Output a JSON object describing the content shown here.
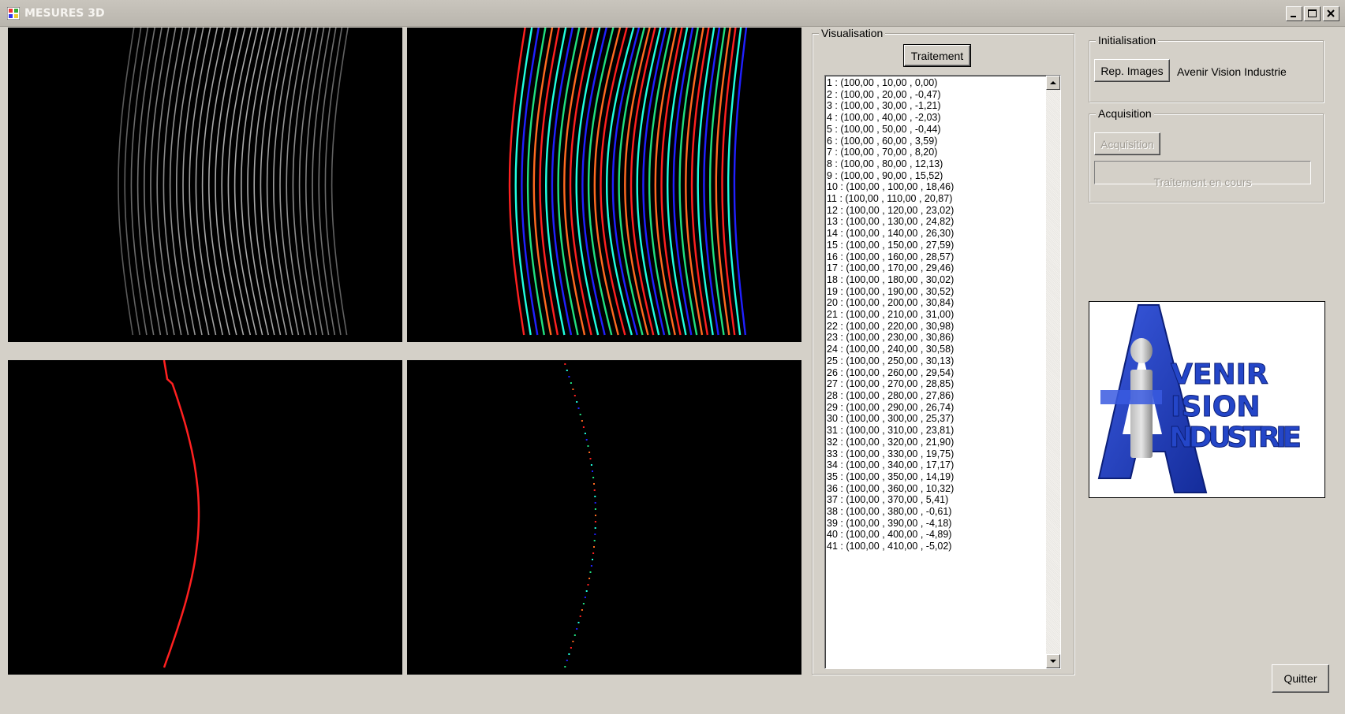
{
  "window": {
    "title": "MESURES 3D",
    "controls": [
      "minimize-icon",
      "maximize-icon",
      "close-icon"
    ]
  },
  "visualisation": {
    "legend": "Visualisation",
    "process_button": "Traitement",
    "results": [
      "1 : (100,00 , 10,00 , 0,00)",
      "2 : (100,00 , 20,00 , -0,47)",
      "3 : (100,00 , 30,00 , -1,21)",
      "4 : (100,00 , 40,00 , -2,03)",
      "5 : (100,00 , 50,00 , -0,44)",
      "6 : (100,00 , 60,00 , 3,59)",
      "7 : (100,00 , 70,00 , 8,20)",
      "8 : (100,00 , 80,00 , 12,13)",
      "9 : (100,00 , 90,00 , 15,52)",
      "10 : (100,00 , 100,00 , 18,46)",
      "11 : (100,00 , 110,00 , 20,87)",
      "12 : (100,00 , 120,00 , 23,02)",
      "13 : (100,00 , 130,00 , 24,82)",
      "14 : (100,00 , 140,00 , 26,30)",
      "15 : (100,00 , 150,00 , 27,59)",
      "16 : (100,00 , 160,00 , 28,57)",
      "17 : (100,00 , 170,00 , 29,46)",
      "18 : (100,00 , 180,00 , 30,02)",
      "19 : (100,00 , 190,00 , 30,52)",
      "20 : (100,00 , 200,00 , 30,84)",
      "21 : (100,00 , 210,00 , 31,00)",
      "22 : (100,00 , 220,00 , 30,98)",
      "23 : (100,00 , 230,00 , 30,86)",
      "24 : (100,00 , 240,00 , 30,58)",
      "25 : (100,00 , 250,00 , 30,13)",
      "26 : (100,00 , 260,00 , 29,54)",
      "27 : (100,00 , 270,00 , 28,85)",
      "28 : (100,00 , 280,00 , 27,86)",
      "29 : (100,00 , 290,00 , 26,74)",
      "30 : (100,00 , 300,00 , 25,37)",
      "31 : (100,00 , 310,00 , 23,81)",
      "32 : (100,00 , 320,00 , 21,90)",
      "33 : (100,00 , 330,00 , 19,75)",
      "34 : (100,00 , 340,00 , 17,17)",
      "35 : (100,00 , 350,00 , 14,19)",
      "36 : (100,00 , 360,00 , 10,32)",
      "37 : (100,00 , 370,00 , 5,41)",
      "38 : (100,00 , 380,00 , -0,61)",
      "39 : (100,00 , 390,00 , -4,18)",
      "40 : (100,00 , 400,00 , -4,89)",
      "41 : (100,00 , 410,00 , -5,02)"
    ]
  },
  "initialisation": {
    "legend": "Initialisation",
    "images_button": "Rep. Images",
    "company_label": "Avenir Vision Industrie"
  },
  "acquisition": {
    "legend": "Acquisition",
    "button": "Acquisition",
    "status": "Traitement en cours"
  },
  "logo": {
    "text_line1": "VENIR",
    "text_line2": "ISION",
    "text_line3": "NDUSTRIE",
    "color": "#1f3fb4"
  },
  "quit_button": "Quitter",
  "colors": {
    "stripe_red": "#ff2020",
    "stripe_blue": "#2020ff",
    "stripe_cyan": "#20ffe0",
    "stripe_green": "#20e080",
    "stripe_orange": "#ff6a20"
  }
}
